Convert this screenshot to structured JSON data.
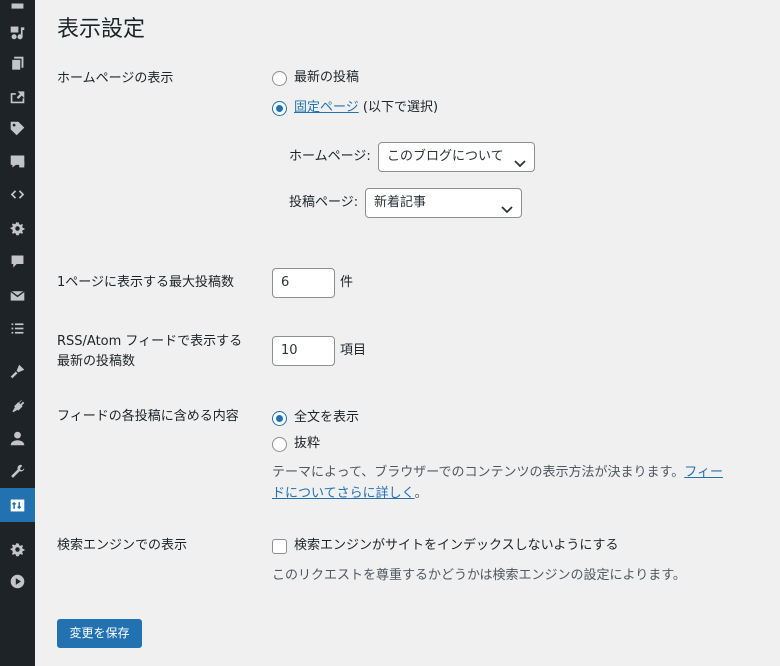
{
  "page": {
    "title": "表示設定"
  },
  "sidebar": {
    "items": [
      {
        "icon": "admin-menu-icon"
      },
      {
        "icon": "media-icon"
      },
      {
        "icon": "pages-icon"
      },
      {
        "icon": "share-icon"
      },
      {
        "icon": "tag-icon"
      },
      {
        "icon": "feedback-icon"
      },
      {
        "icon": "code-icon"
      },
      {
        "icon": "gear-icon"
      },
      {
        "icon": "comments-icon"
      },
      {
        "icon": "mail-icon"
      },
      {
        "icon": "list-icon"
      },
      {
        "icon": "appearance-icon"
      },
      {
        "icon": "plugins-icon"
      },
      {
        "icon": "users-icon"
      },
      {
        "icon": "tools-icon"
      },
      {
        "icon": "settings-active-icon"
      },
      {
        "icon": "gear-icon"
      },
      {
        "icon": "play-icon"
      }
    ]
  },
  "homepage_display": {
    "label": "ホームページの表示",
    "option_latest": "最新の投稿",
    "option_static_link": "固定ページ",
    "option_static_suffix": " (以下で選択)",
    "selected": "static",
    "homepage_label": "ホームページ:",
    "homepage_value": "このブログについて",
    "postspage_label": "投稿ページ:",
    "postspage_value": "新着記事"
  },
  "posts_per_page": {
    "label": "1ページに表示する最大投稿数",
    "value": "6",
    "unit": "件"
  },
  "feed_posts": {
    "label_line1": "RSS/Atom フィードで表示する",
    "label_line2": "最新の投稿数",
    "value": "10",
    "unit": "項目"
  },
  "feed_content": {
    "label": "フィードの各投稿に含める内容",
    "option_full": "全文を表示",
    "option_excerpt": "抜粋",
    "selected": "full",
    "desc_line1": "テーマによって、ブラウザーでのコンテンツの表示方法が決まります。",
    "desc_link_part1": "フィー",
    "desc_link_part2": "ドについてさらに詳しく",
    "desc_end": "。"
  },
  "search_engine": {
    "label": "検索エンジンでの表示",
    "checkbox_label": "検索エンジンがサイトをインデックスしないようにする",
    "checked": false,
    "desc": "このリクエストを尊重するかどうかは検索エンジンの設定によります。"
  },
  "actions": {
    "save_label": "変更を保存"
  }
}
